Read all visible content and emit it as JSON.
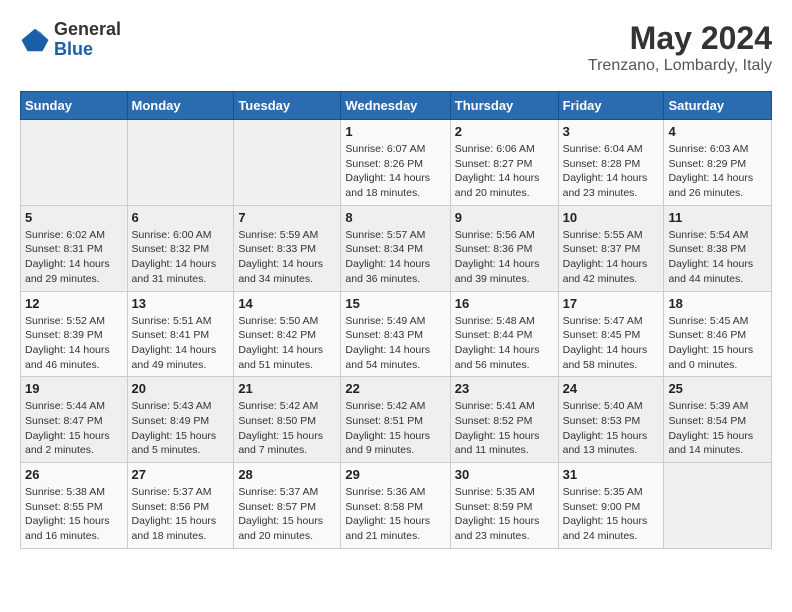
{
  "header": {
    "logo_general": "General",
    "logo_blue": "Blue",
    "month_year": "May 2024",
    "location": "Trenzano, Lombardy, Italy"
  },
  "days_of_week": [
    "Sunday",
    "Monday",
    "Tuesday",
    "Wednesday",
    "Thursday",
    "Friday",
    "Saturday"
  ],
  "weeks": [
    [
      {
        "day": "",
        "info": ""
      },
      {
        "day": "",
        "info": ""
      },
      {
        "day": "",
        "info": ""
      },
      {
        "day": "1",
        "info": "Sunrise: 6:07 AM\nSunset: 8:26 PM\nDaylight: 14 hours and 18 minutes."
      },
      {
        "day": "2",
        "info": "Sunrise: 6:06 AM\nSunset: 8:27 PM\nDaylight: 14 hours and 20 minutes."
      },
      {
        "day": "3",
        "info": "Sunrise: 6:04 AM\nSunset: 8:28 PM\nDaylight: 14 hours and 23 minutes."
      },
      {
        "day": "4",
        "info": "Sunrise: 6:03 AM\nSunset: 8:29 PM\nDaylight: 14 hours and 26 minutes."
      }
    ],
    [
      {
        "day": "5",
        "info": "Sunrise: 6:02 AM\nSunset: 8:31 PM\nDaylight: 14 hours and 29 minutes."
      },
      {
        "day": "6",
        "info": "Sunrise: 6:00 AM\nSunset: 8:32 PM\nDaylight: 14 hours and 31 minutes."
      },
      {
        "day": "7",
        "info": "Sunrise: 5:59 AM\nSunset: 8:33 PM\nDaylight: 14 hours and 34 minutes."
      },
      {
        "day": "8",
        "info": "Sunrise: 5:57 AM\nSunset: 8:34 PM\nDaylight: 14 hours and 36 minutes."
      },
      {
        "day": "9",
        "info": "Sunrise: 5:56 AM\nSunset: 8:36 PM\nDaylight: 14 hours and 39 minutes."
      },
      {
        "day": "10",
        "info": "Sunrise: 5:55 AM\nSunset: 8:37 PM\nDaylight: 14 hours and 42 minutes."
      },
      {
        "day": "11",
        "info": "Sunrise: 5:54 AM\nSunset: 8:38 PM\nDaylight: 14 hours and 44 minutes."
      }
    ],
    [
      {
        "day": "12",
        "info": "Sunrise: 5:52 AM\nSunset: 8:39 PM\nDaylight: 14 hours and 46 minutes."
      },
      {
        "day": "13",
        "info": "Sunrise: 5:51 AM\nSunset: 8:41 PM\nDaylight: 14 hours and 49 minutes."
      },
      {
        "day": "14",
        "info": "Sunrise: 5:50 AM\nSunset: 8:42 PM\nDaylight: 14 hours and 51 minutes."
      },
      {
        "day": "15",
        "info": "Sunrise: 5:49 AM\nSunset: 8:43 PM\nDaylight: 14 hours and 54 minutes."
      },
      {
        "day": "16",
        "info": "Sunrise: 5:48 AM\nSunset: 8:44 PM\nDaylight: 14 hours and 56 minutes."
      },
      {
        "day": "17",
        "info": "Sunrise: 5:47 AM\nSunset: 8:45 PM\nDaylight: 14 hours and 58 minutes."
      },
      {
        "day": "18",
        "info": "Sunrise: 5:45 AM\nSunset: 8:46 PM\nDaylight: 15 hours and 0 minutes."
      }
    ],
    [
      {
        "day": "19",
        "info": "Sunrise: 5:44 AM\nSunset: 8:47 PM\nDaylight: 15 hours and 2 minutes."
      },
      {
        "day": "20",
        "info": "Sunrise: 5:43 AM\nSunset: 8:49 PM\nDaylight: 15 hours and 5 minutes."
      },
      {
        "day": "21",
        "info": "Sunrise: 5:42 AM\nSunset: 8:50 PM\nDaylight: 15 hours and 7 minutes."
      },
      {
        "day": "22",
        "info": "Sunrise: 5:42 AM\nSunset: 8:51 PM\nDaylight: 15 hours and 9 minutes."
      },
      {
        "day": "23",
        "info": "Sunrise: 5:41 AM\nSunset: 8:52 PM\nDaylight: 15 hours and 11 minutes."
      },
      {
        "day": "24",
        "info": "Sunrise: 5:40 AM\nSunset: 8:53 PM\nDaylight: 15 hours and 13 minutes."
      },
      {
        "day": "25",
        "info": "Sunrise: 5:39 AM\nSunset: 8:54 PM\nDaylight: 15 hours and 14 minutes."
      }
    ],
    [
      {
        "day": "26",
        "info": "Sunrise: 5:38 AM\nSunset: 8:55 PM\nDaylight: 15 hours and 16 minutes."
      },
      {
        "day": "27",
        "info": "Sunrise: 5:37 AM\nSunset: 8:56 PM\nDaylight: 15 hours and 18 minutes."
      },
      {
        "day": "28",
        "info": "Sunrise: 5:37 AM\nSunset: 8:57 PM\nDaylight: 15 hours and 20 minutes."
      },
      {
        "day": "29",
        "info": "Sunrise: 5:36 AM\nSunset: 8:58 PM\nDaylight: 15 hours and 21 minutes."
      },
      {
        "day": "30",
        "info": "Sunrise: 5:35 AM\nSunset: 8:59 PM\nDaylight: 15 hours and 23 minutes."
      },
      {
        "day": "31",
        "info": "Sunrise: 5:35 AM\nSunset: 9:00 PM\nDaylight: 15 hours and 24 minutes."
      },
      {
        "day": "",
        "info": ""
      }
    ]
  ]
}
